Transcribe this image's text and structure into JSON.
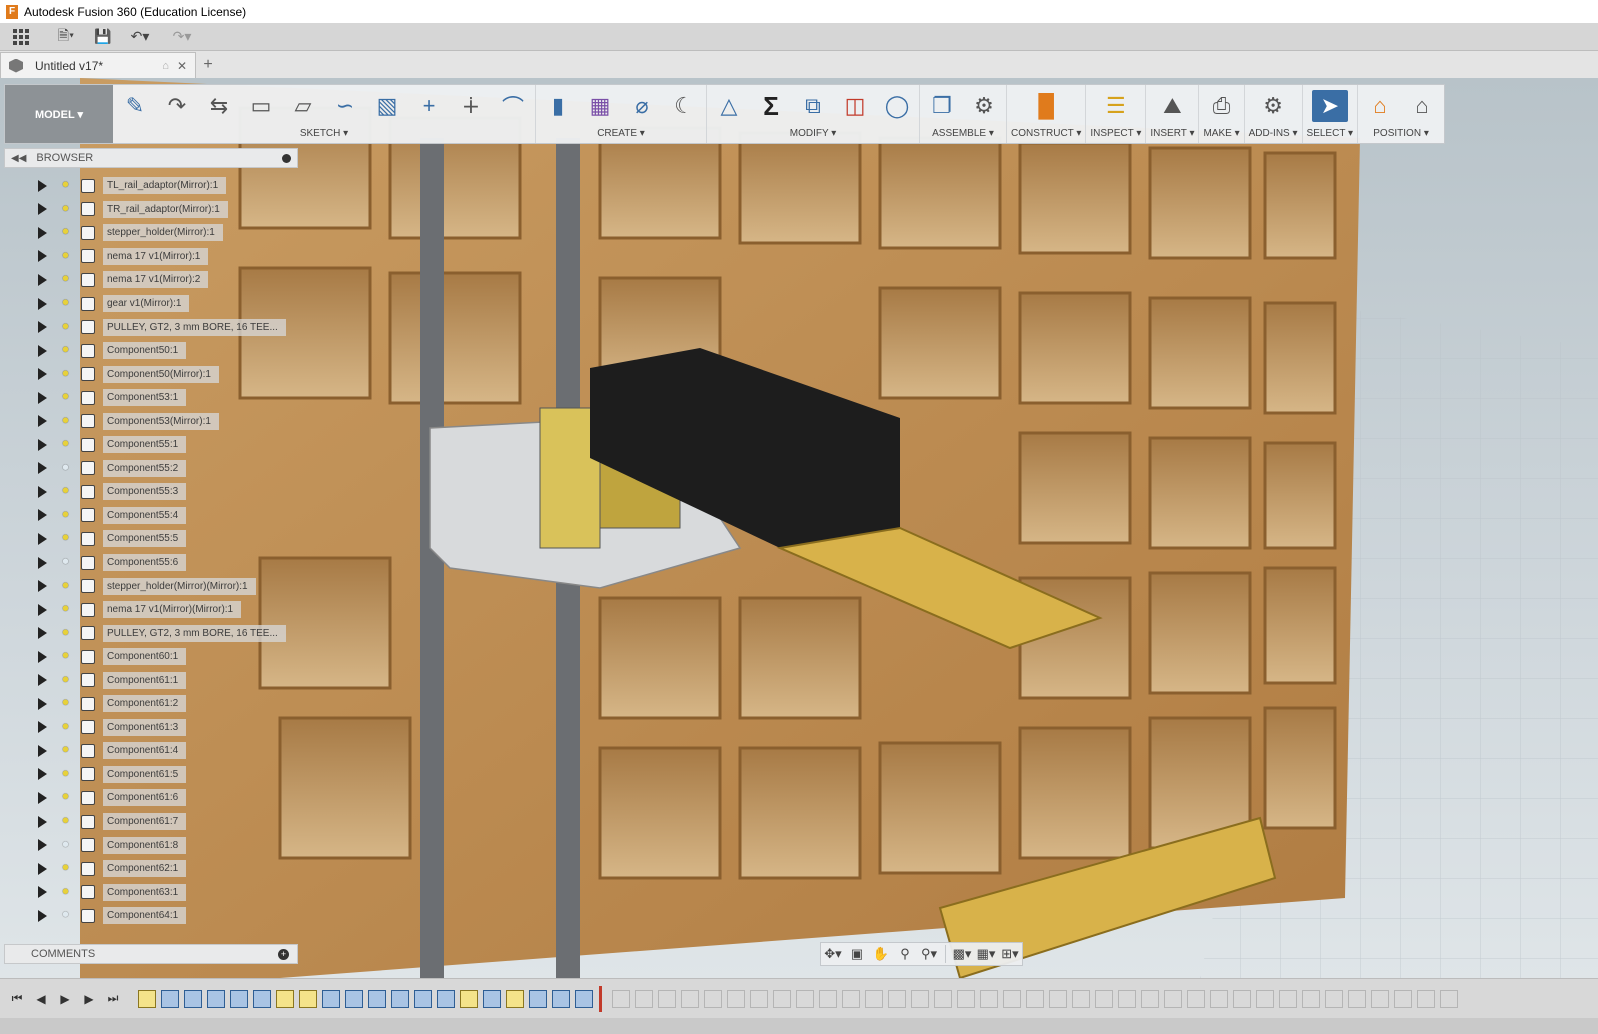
{
  "window": {
    "title": "Autodesk Fusion 360 (Education License)"
  },
  "quick_access": {
    "icons": [
      "app-grid-icon",
      "file-icon",
      "save-icon",
      "undo-icon",
      "redo-icon"
    ]
  },
  "document": {
    "tab_title": "Untitled v17*"
  },
  "toolbar": {
    "workspace": "MODEL ▾",
    "groups": [
      {
        "label": "SKETCH ▾"
      },
      {
        "label": "CREATE ▾"
      },
      {
        "label": "MODIFY ▾"
      },
      {
        "label": "ASSEMBLE ▾"
      },
      {
        "label": "CONSTRUCT ▾"
      },
      {
        "label": "INSPECT ▾"
      },
      {
        "label": "INSERT ▾"
      },
      {
        "label": "MAKE ▾"
      },
      {
        "label": "ADD-INS ▾"
      },
      {
        "label": "SELECT ▾"
      },
      {
        "label": "POSITION ▾"
      }
    ]
  },
  "browser": {
    "title": "BROWSER",
    "items": [
      {
        "label": "TL_rail_adaptor(Mirror):1",
        "visible": true
      },
      {
        "label": "TR_rail_adaptor(Mirror):1",
        "visible": true
      },
      {
        "label": "stepper_holder(Mirror):1",
        "visible": true
      },
      {
        "label": "nema 17 v1(Mirror):1",
        "visible": true
      },
      {
        "label": "nema 17 v1(Mirror):2",
        "visible": true
      },
      {
        "label": "gear v1(Mirror):1",
        "visible": true
      },
      {
        "label": "PULLEY, GT2, 3 mm BORE, 16 TEE...",
        "visible": true
      },
      {
        "label": "Component50:1",
        "visible": true
      },
      {
        "label": "Component50(Mirror):1",
        "visible": true
      },
      {
        "label": "Component53:1",
        "visible": true
      },
      {
        "label": "Component53(Mirror):1",
        "visible": true
      },
      {
        "label": "Component55:1",
        "visible": true
      },
      {
        "label": "Component55:2",
        "visible": false
      },
      {
        "label": "Component55:3",
        "visible": true
      },
      {
        "label": "Component55:4",
        "visible": true
      },
      {
        "label": "Component55:5",
        "visible": true
      },
      {
        "label": "Component55:6",
        "visible": false
      },
      {
        "label": "stepper_holder(Mirror)(Mirror):1",
        "visible": true
      },
      {
        "label": "nema 17 v1(Mirror)(Mirror):1",
        "visible": true
      },
      {
        "label": "PULLEY, GT2, 3 mm BORE, 16 TEE...",
        "visible": true
      },
      {
        "label": "Component60:1",
        "visible": true
      },
      {
        "label": "Component61:1",
        "visible": true
      },
      {
        "label": "Component61:2",
        "visible": true
      },
      {
        "label": "Component61:3",
        "visible": true
      },
      {
        "label": "Component61:4",
        "visible": true
      },
      {
        "label": "Component61:5",
        "visible": true
      },
      {
        "label": "Component61:6",
        "visible": true
      },
      {
        "label": "Component61:7",
        "visible": true
      },
      {
        "label": "Component61:8",
        "visible": false
      },
      {
        "label": "Component62:1",
        "visible": true
      },
      {
        "label": "Component63:1",
        "visible": true
      },
      {
        "label": "Component64:1",
        "visible": false
      }
    ]
  },
  "comments": {
    "title": "COMMENTS"
  },
  "colors": {
    "wood": "#c89a5e",
    "accent_blue": "#3a6ea5",
    "ground": "#d8dde0"
  }
}
